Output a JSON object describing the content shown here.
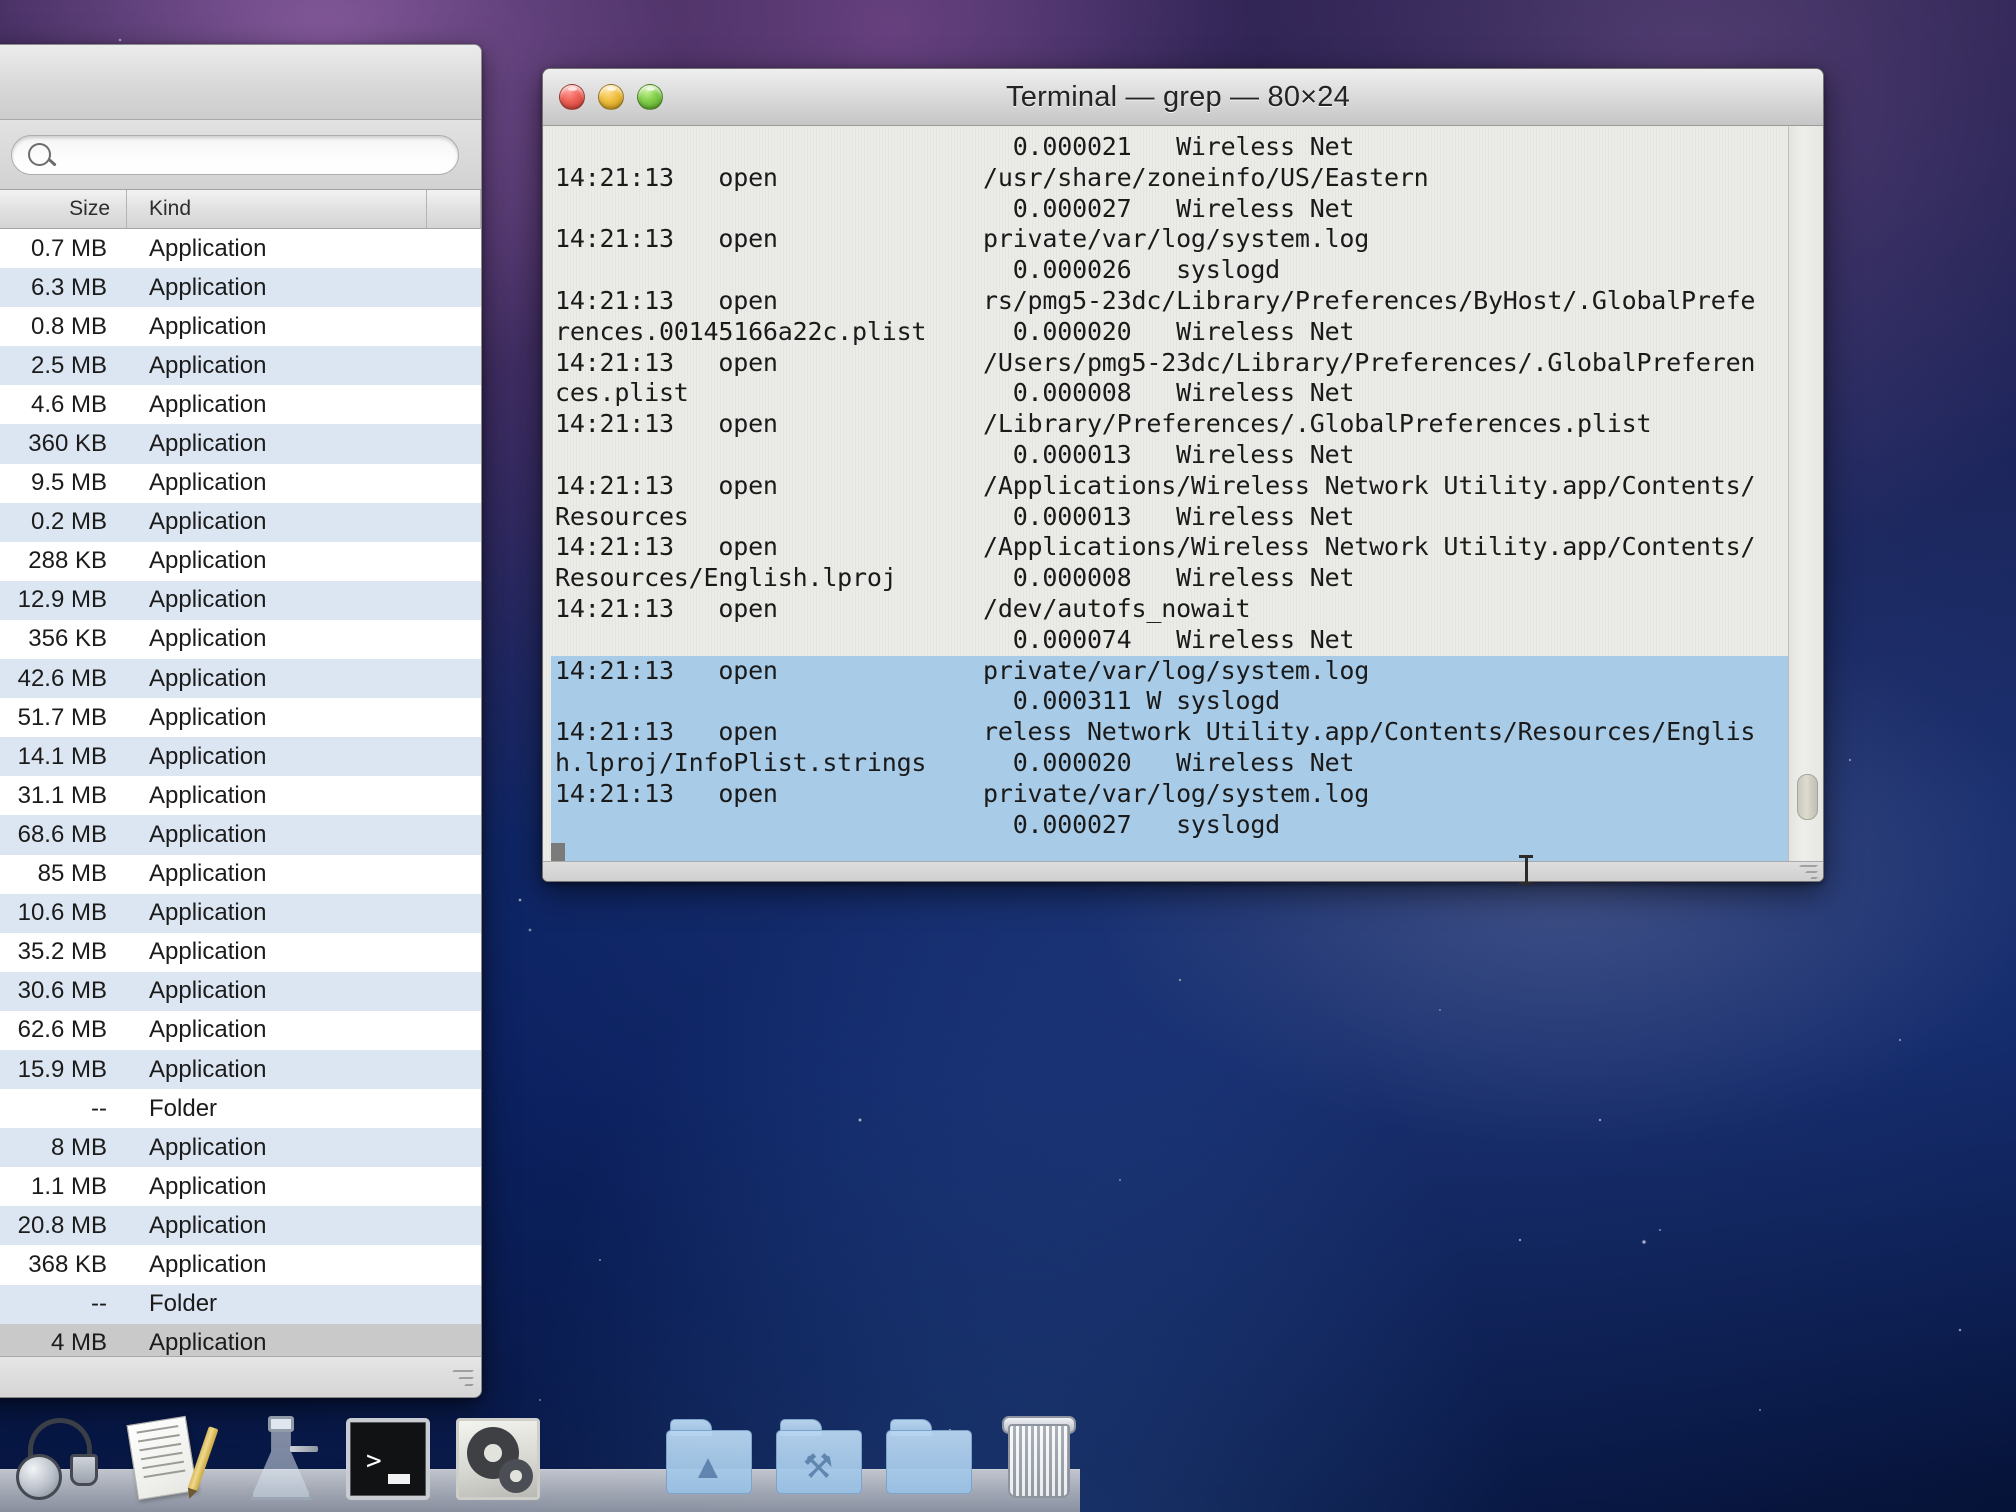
{
  "desktop": {
    "wallpaper_name": "galaxy-space-wallpaper"
  },
  "finder_window": {
    "search": {
      "placeholder": "",
      "value": "",
      "icon": "search-icon"
    },
    "columns": [
      "Size",
      "Kind"
    ],
    "rows": [
      {
        "size": "0.7 MB",
        "kind": "Application"
      },
      {
        "size": "6.3 MB",
        "kind": "Application"
      },
      {
        "size": "0.8 MB",
        "kind": "Application"
      },
      {
        "size": "2.5 MB",
        "kind": "Application"
      },
      {
        "size": "4.6 MB",
        "kind": "Application"
      },
      {
        "size": "360 KB",
        "kind": "Application"
      },
      {
        "size": "9.5 MB",
        "kind": "Application"
      },
      {
        "size": "0.2 MB",
        "kind": "Application"
      },
      {
        "size": "288 KB",
        "kind": "Application"
      },
      {
        "size": "12.9 MB",
        "kind": "Application"
      },
      {
        "size": "356 KB",
        "kind": "Application"
      },
      {
        "size": "42.6 MB",
        "kind": "Application"
      },
      {
        "size": "51.7 MB",
        "kind": "Application"
      },
      {
        "size": "14.1 MB",
        "kind": "Application"
      },
      {
        "size": "31.1 MB",
        "kind": "Application"
      },
      {
        "size": "68.6 MB",
        "kind": "Application"
      },
      {
        "size": "85 MB",
        "kind": "Application"
      },
      {
        "size": "10.6 MB",
        "kind": "Application"
      },
      {
        "size": "35.2 MB",
        "kind": "Application"
      },
      {
        "size": "30.6 MB",
        "kind": "Application"
      },
      {
        "size": "62.6 MB",
        "kind": "Application"
      },
      {
        "size": "15.9 MB",
        "kind": "Application"
      },
      {
        "size": "--",
        "kind": "Folder"
      },
      {
        "size": "8 MB",
        "kind": "Application"
      },
      {
        "size": "1.1 MB",
        "kind": "Application"
      },
      {
        "size": "20.8 MB",
        "kind": "Application"
      },
      {
        "size": "368 KB",
        "kind": "Application"
      },
      {
        "size": "--",
        "kind": "Folder"
      },
      {
        "size": "4 MB",
        "kind": "Application",
        "selected": true
      }
    ]
  },
  "terminal_window": {
    "title": "Terminal — grep — 80×24",
    "traffic_lights": [
      "close-button",
      "minimize-button",
      "zoom-button"
    ],
    "lines": [
      {
        "left": "",
        "right": "  0.000021   Wireless Net",
        "selected": false
      },
      {
        "left": "14:21:13   open",
        "right": "/usr/share/zoneinfo/US/Eastern",
        "selected": false
      },
      {
        "left": "",
        "right": "  0.000027   Wireless Net",
        "selected": false
      },
      {
        "left": "14:21:13   open",
        "right": "private/var/log/system.log",
        "selected": false
      },
      {
        "left": "",
        "right": "  0.000026   syslogd",
        "selected": false
      },
      {
        "left": "14:21:13   open",
        "right": "rs/pmg5-23dc/Library/Preferences/ByHost/.GlobalPrefe",
        "selected": false
      },
      {
        "left": "rences.00145166a22c.plist",
        "right": "  0.000020   Wireless Net",
        "selected": false
      },
      {
        "left": "14:21:13   open",
        "right": "/Users/pmg5-23dc/Library/Preferences/.GlobalPreferen",
        "selected": false
      },
      {
        "left": "ces.plist",
        "right": "  0.000008   Wireless Net",
        "selected": false
      },
      {
        "left": "14:21:13   open",
        "right": "/Library/Preferences/.GlobalPreferences.plist",
        "selected": false
      },
      {
        "left": "",
        "right": "  0.000013   Wireless Net",
        "selected": false
      },
      {
        "left": "14:21:13   open",
        "right": "/Applications/Wireless Network Utility.app/Contents/",
        "selected": false
      },
      {
        "left": "Resources",
        "right": "  0.000013   Wireless Net",
        "selected": false
      },
      {
        "left": "14:21:13   open",
        "right": "/Applications/Wireless Network Utility.app/Contents/",
        "selected": false
      },
      {
        "left": "Resources/English.lproj",
        "right": "  0.000008   Wireless Net",
        "selected": false
      },
      {
        "left": "14:21:13   open",
        "right": "/dev/autofs_nowait",
        "selected": false
      },
      {
        "left": "",
        "right": "  0.000074   Wireless Net",
        "selected": false
      },
      {
        "left": "14:21:13   open",
        "right": "private/var/log/system.log",
        "selected": true
      },
      {
        "left": "",
        "right": "  0.000311 W syslogd",
        "selected": true
      },
      {
        "left": "14:21:13   open",
        "right": "reless Network Utility.app/Contents/Resources/Englis",
        "selected": true
      },
      {
        "left": "h.lproj/InfoPlist.strings",
        "right": "  0.000020   Wireless Net",
        "selected": true
      },
      {
        "left": "14:21:13   open",
        "right": "private/var/log/system.log",
        "selected": true
      },
      {
        "left": "",
        "right": "  0.000027   syslogd",
        "selected": true
      },
      {
        "left": "",
        "right": "",
        "selected": true
      }
    ],
    "scrollbar": "vertical-scrollbar",
    "selection_color": "#a8cbe8"
  },
  "dock": {
    "items": [
      {
        "name": "activity-monitor",
        "icon": "stethoscope-icon"
      },
      {
        "name": "textedit",
        "icon": "paper-pencil-icon"
      },
      {
        "name": "disk-utility",
        "icon": "flask-icon"
      },
      {
        "name": "terminal",
        "icon": "terminal-icon"
      },
      {
        "name": "system-preferences",
        "icon": "gears-icon"
      },
      {
        "name": "applications-folder",
        "icon": "folder-icon"
      },
      {
        "name": "utilities-folder",
        "icon": "folder-tools-icon"
      },
      {
        "name": "documents-folder",
        "icon": "folder-icon"
      },
      {
        "name": "trash",
        "icon": "trash-icon"
      }
    ]
  }
}
